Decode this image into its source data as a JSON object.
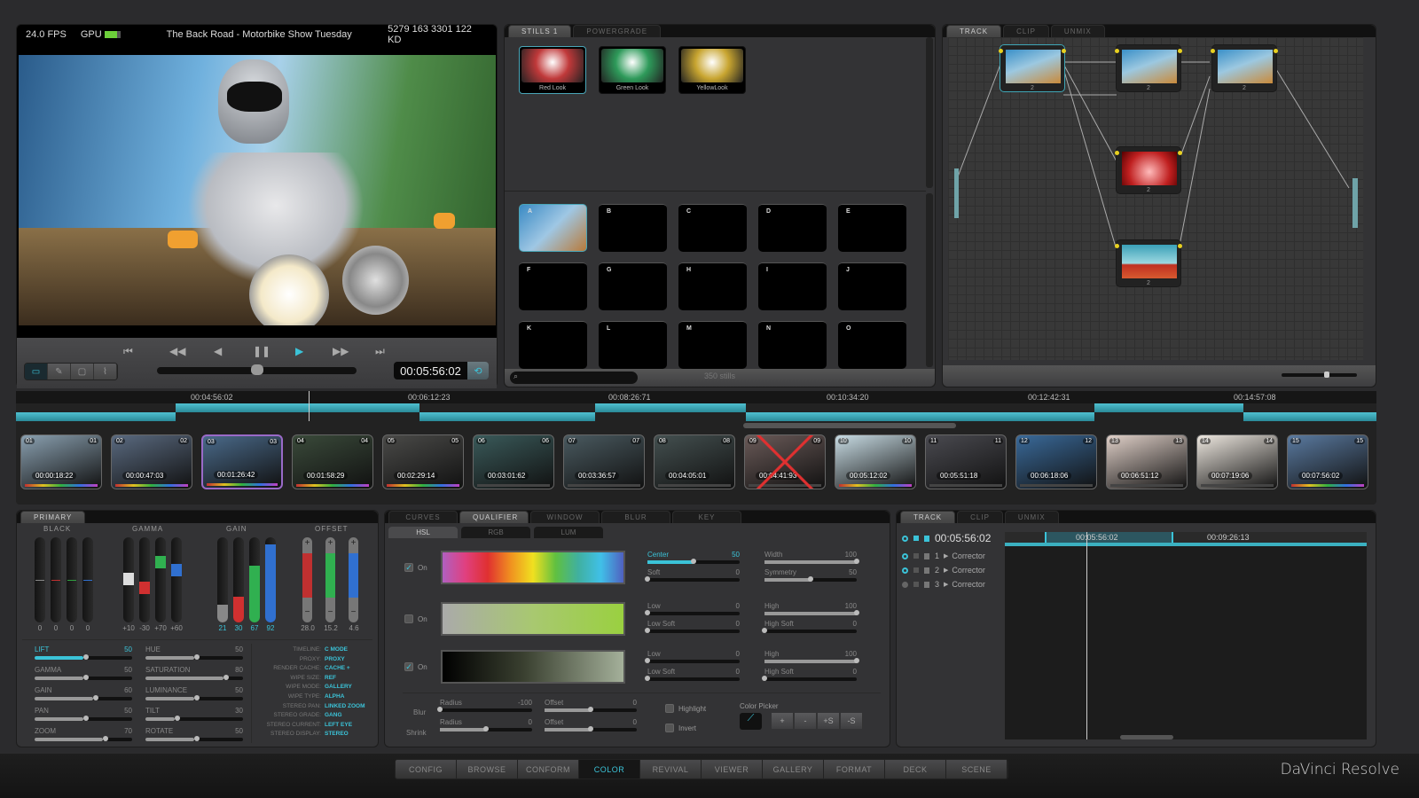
{
  "viewer": {
    "fps": "24.0 FPS",
    "gpu_label": "GPU",
    "title": "The Back Road - Motorbike Show Tuesday",
    "keycode": "5279 163 3301 122 KD",
    "timecode": "00:05:56:02",
    "jog_position": 0.5,
    "transport": [
      "skip-to-start",
      "rewind",
      "step-back",
      "pause",
      "play",
      "fast-forward",
      "skip-to-end"
    ]
  },
  "stills": {
    "tabs": [
      "STILLS 1",
      "POWERGRADE"
    ],
    "looks": [
      {
        "label": "Red Look",
        "color": "#c0393a"
      },
      {
        "label": "Green Look",
        "color": "#2e9a5a"
      },
      {
        "label": "YellowLook",
        "color": "#c8a530"
      }
    ],
    "slots": [
      "A",
      "B",
      "C",
      "D",
      "E",
      "F",
      "G",
      "H",
      "I",
      "J",
      "K",
      "L",
      "M",
      "N",
      "O"
    ],
    "count": "350 stills"
  },
  "nodes": {
    "tabs": [
      "TRACK",
      "CLIP",
      "UNMIX"
    ],
    "items": [
      {
        "label": "2",
        "tint": "normal"
      },
      {
        "label": "2",
        "tint": "normal"
      },
      {
        "label": "2",
        "tint": "normal"
      },
      {
        "label": "2",
        "tint": "red"
      },
      {
        "label": "2",
        "tint": "split"
      }
    ]
  },
  "timeline": {
    "ruler": [
      "00:04:56:02",
      "00:06:12:23",
      "00:08:26:71",
      "00:10:34:20",
      "00:12:42:31",
      "00:14:57:08"
    ],
    "clips": [
      {
        "num": "01",
        "tc": "00:00:18:22"
      },
      {
        "num": "02",
        "tc": "00:00:47:03"
      },
      {
        "num": "03",
        "tc": "00:01:26:42"
      },
      {
        "num": "04",
        "tc": "00:01:58:29"
      },
      {
        "num": "05",
        "tc": "00:02:29:14"
      },
      {
        "num": "06",
        "tc": "00:03:01:62"
      },
      {
        "num": "07",
        "tc": "00:03:36:57"
      },
      {
        "num": "08",
        "tc": "00:04:05:01"
      },
      {
        "num": "09",
        "tc": "00:04:41:93"
      },
      {
        "num": "10",
        "tc": "00:05:12:02"
      },
      {
        "num": "11",
        "tc": "00:05:51:18"
      },
      {
        "num": "12",
        "tc": "00:06:18:06"
      },
      {
        "num": "13",
        "tc": "00:06:51:12"
      },
      {
        "num": "14",
        "tc": "00:07:19:06"
      },
      {
        "num": "15",
        "tc": "00:07:56:02"
      }
    ]
  },
  "primary": {
    "tab": "PRIMARY",
    "groups": [
      {
        "name": "BLACK",
        "values": [
          "0",
          "0",
          "0",
          "0"
        ]
      },
      {
        "name": "GAMMA",
        "values": [
          "+10",
          "-30",
          "+70",
          "+60"
        ]
      },
      {
        "name": "GAIN",
        "values": [
          "21",
          "30",
          "67",
          "92"
        ]
      },
      {
        "name": "OFFSET",
        "values": [
          "28.0",
          "15.2",
          "4.6"
        ]
      }
    ],
    "sliders_left": [
      {
        "label": "LIFT",
        "value": "50"
      },
      {
        "label": "GAMMA",
        "value": "50"
      },
      {
        "label": "GAIN",
        "value": "60"
      },
      {
        "label": "PAN",
        "value": "50"
      },
      {
        "label": "ZOOM",
        "value": "70"
      }
    ],
    "sliders_right": [
      {
        "label": "HUE",
        "value": "50"
      },
      {
        "label": "SATURATION",
        "value": "80"
      },
      {
        "label": "LUMINANCE",
        "value": "50"
      },
      {
        "label": "TILT",
        "value": "30"
      },
      {
        "label": "ROTATE",
        "value": "50"
      }
    ],
    "info": [
      {
        "k": "TIMELINE:",
        "v": "C MODE"
      },
      {
        "k": "PROXY:",
        "v": "PROXY"
      },
      {
        "k": "RENDER CACHE:",
        "v": "CACHE +"
      },
      {
        "k": "WIPE SIZE:",
        "v": "REF"
      },
      {
        "k": "WIPE MODE:",
        "v": "GALLERY"
      },
      {
        "k": "WIPE TYPE:",
        "v": "ALPHA"
      },
      {
        "k": "STEREO PAN:",
        "v": "LINKED ZOOM"
      },
      {
        "k": "STEREO GRADE:",
        "v": "GANG"
      },
      {
        "k": "STEREO CURRENT:",
        "v": "LEFT EYE"
      },
      {
        "k": "STEREO DISPLAY:",
        "v": "STEREO"
      }
    ]
  },
  "qualifier": {
    "tabs": [
      "CURVES",
      "QUALIFIER",
      "WINDOW",
      "BLUR",
      "KEY"
    ],
    "subtabs": [
      "HSL",
      "RGB",
      "LUM"
    ],
    "on_label": "On",
    "rows": [
      {
        "checked": true,
        "sliders": [
          {
            "label": "Center",
            "value": "50"
          },
          {
            "label": "Width",
            "value": "100"
          },
          {
            "label": "Soft",
            "value": "0"
          },
          {
            "label": "Symmetry",
            "value": "50"
          }
        ]
      },
      {
        "checked": false,
        "sliders": [
          {
            "label": "Low",
            "value": "0"
          },
          {
            "label": "High",
            "value": "100"
          },
          {
            "label": "Low Soft",
            "value": "0"
          },
          {
            "label": "High Soft",
            "value": "0"
          }
        ]
      },
      {
        "checked": true,
        "sliders": [
          {
            "label": "Low",
            "value": "0"
          },
          {
            "label": "High",
            "value": "100"
          },
          {
            "label": "Low Soft",
            "value": "0"
          },
          {
            "label": "High Soft",
            "value": "0"
          }
        ]
      }
    ],
    "blur_label": "Blur",
    "shrink_label": "Shrink",
    "blur": [
      {
        "label": "Radius",
        "value": "-100"
      },
      {
        "label": "Offset",
        "value": "0"
      }
    ],
    "shrink": [
      {
        "label": "Radius",
        "value": "0"
      },
      {
        "label": "Offset",
        "value": "0"
      }
    ],
    "highlight_label": "Highlight",
    "invert_label": "Invert",
    "picker_label": "Color Picker",
    "picker_buttons": [
      "+",
      "-",
      "+S",
      "-S"
    ]
  },
  "track": {
    "tabs": [
      "TRACK",
      "CLIP",
      "UNMIX"
    ],
    "timecode": "00:05:56:02",
    "ruler": [
      "00:05:56:02",
      "00:09:26:13"
    ],
    "rows": [
      {
        "num": "1",
        "label": "Corrector",
        "on": true
      },
      {
        "num": "2",
        "label": "Corrector",
        "on": true
      },
      {
        "num": "3",
        "label": "Corrector",
        "on": false
      }
    ]
  },
  "nav": {
    "items": [
      "CONFIG",
      "BROWSE",
      "CONFORM",
      "COLOR",
      "REVIVAL",
      "VIEWER",
      "GALLERY",
      "FORMAT",
      "DECK",
      "SCENE"
    ],
    "active": "COLOR",
    "brand": "DaVinci Resolve"
  },
  "colors": {
    "accent": "#3bc3d8"
  }
}
